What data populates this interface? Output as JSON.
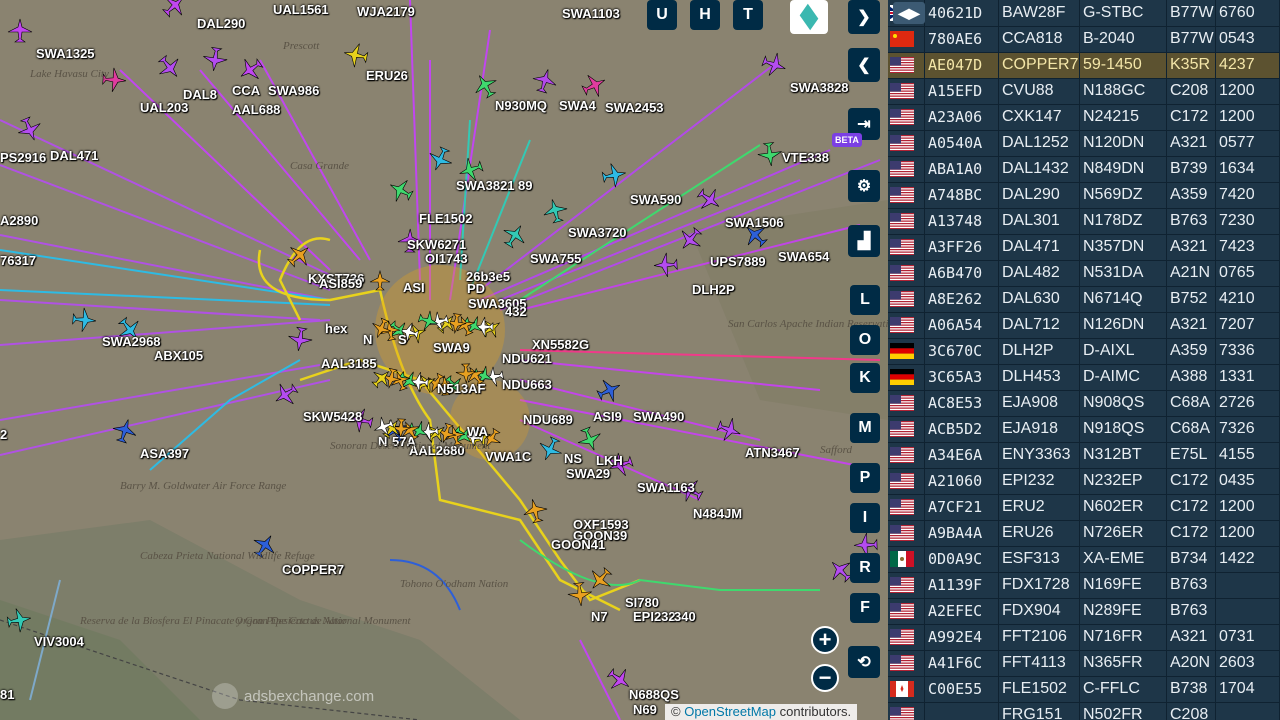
{
  "map": {
    "attribution_prefix": "©",
    "attribution_link": "OpenStreetMap",
    "attribution_suffix": "contributors.",
    "watermark": "adsbexchange.com",
    "beta_badge": "BETA",
    "place_labels": [
      "Prescott",
      "Lake Havasu City",
      "Barry M. Goldwater Air Force Range",
      "Cabeza Prieta National Wildlife Refuge",
      "Organ Pipe Cactus National Monument",
      "Tohono O'odham Nation",
      "Reserva de la Biosfera El Pinacate y Gran Desierto de Altar",
      "San Carlos Apache Indian Reservation",
      "Safford",
      "Casa Grande",
      "Sonoran Desert National Monument"
    ],
    "aircraft_labels": [
      "DAL290",
      "UAL1561",
      "WJA2179",
      "SWA1103",
      "SWA1325",
      "DAL8",
      "UAL203",
      "SWA986",
      "CCA",
      "AAL688",
      "ERU26",
      "N930MQ",
      "SWA4",
      "SWA2453",
      "SWA3828",
      "PS2916",
      "DAL471",
      "SWA3821",
      "89",
      "VTE338",
      "FLE1502",
      "SKW6271",
      "OI1743",
      "26b3e5",
      "SWA590",
      "A2890",
      "SWA3720",
      "SWA1506",
      "SWA755",
      "UPS7889",
      "SWA654",
      "76317",
      "KXST736",
      "ASI859",
      "ASI",
      "PD",
      "DLH2P",
      "SWA3605",
      "432",
      "hex",
      "N",
      "S",
      "SWA2968",
      "ABX105",
      "SWA9",
      "XN5582G",
      "NDU621",
      "AAL3185",
      "N513AF",
      "NDU663",
      "SKW5428",
      "ASI9",
      "SWA490",
      "NDU689",
      "N",
      "57A",
      "WA",
      "ASA397",
      "AAL2680",
      "VWA1C",
      "NS",
      "LKH",
      "ATN3467",
      "SWA29",
      "SWA1163",
      "N484JM",
      "OXF1593",
      "GOON39",
      "GOON41",
      "COPPER7",
      "VIV3004",
      "SI780",
      "EPI232",
      "N7",
      "340",
      "N688QS",
      "N69",
      "81",
      "2"
    ]
  },
  "toolbar": {
    "btn_u": "U",
    "btn_h": "H",
    "btn_t": "T",
    "expand_icon": "chevron-right-icon",
    "collapse_icon": "chevron-left-icon",
    "letter_buttons": [
      "L",
      "O",
      "K",
      "M",
      "P",
      "I",
      "R",
      "F"
    ],
    "zoom_in": "+",
    "zoom_out": "−"
  },
  "table": {
    "toggle_icon": "arrows-icon",
    "rows": [
      {
        "flag": "uk",
        "hex": "40621D",
        "callsign": "BAW28F",
        "reg": "G-STBC",
        "type": "B77W",
        "squawk": "6760"
      },
      {
        "flag": "cn",
        "hex": "780AE6",
        "callsign": "CCA818",
        "reg": "B-2040",
        "type": "B77W",
        "squawk": "0543"
      },
      {
        "flag": "us",
        "hex": "AE047D",
        "callsign": "COPPER7",
        "reg": "59-1450",
        "type": "K35R",
        "squawk": "4237",
        "selected": true
      },
      {
        "flag": "us",
        "hex": "A15EFD",
        "callsign": "CVU88",
        "reg": "N188GC",
        "type": "C208",
        "squawk": "1200"
      },
      {
        "flag": "us",
        "hex": "A23A06",
        "callsign": "CXK147",
        "reg": "N24215",
        "type": "C172",
        "squawk": "1200"
      },
      {
        "flag": "us",
        "hex": "A0540A",
        "callsign": "DAL1252",
        "reg": "N120DN",
        "type": "A321",
        "squawk": "0577"
      },
      {
        "flag": "us",
        "hex": "ABA1A0",
        "callsign": "DAL1432",
        "reg": "N849DN",
        "type": "B739",
        "squawk": "1634"
      },
      {
        "flag": "us",
        "hex": "A748BC",
        "callsign": "DAL290",
        "reg": "N569DZ",
        "type": "A359",
        "squawk": "7420"
      },
      {
        "flag": "us",
        "hex": "A13748",
        "callsign": "DAL301",
        "reg": "N178DZ",
        "type": "B763",
        "squawk": "7230"
      },
      {
        "flag": "us",
        "hex": "A3FF26",
        "callsign": "DAL471",
        "reg": "N357DN",
        "type": "A321",
        "squawk": "7423"
      },
      {
        "flag": "us",
        "hex": "A6B470",
        "callsign": "DAL482",
        "reg": "N531DA",
        "type": "A21N",
        "squawk": "0765"
      },
      {
        "flag": "us",
        "hex": "A8E262",
        "callsign": "DAL630",
        "reg": "N6714Q",
        "type": "B752",
        "squawk": "4210"
      },
      {
        "flag": "us",
        "hex": "A06A54",
        "callsign": "DAL712",
        "reg": "N126DN",
        "type": "A321",
        "squawk": "7207"
      },
      {
        "flag": "de",
        "hex": "3C670C",
        "callsign": "DLH2P",
        "reg": "D-AIXL",
        "type": "A359",
        "squawk": "7336"
      },
      {
        "flag": "de",
        "hex": "3C65A3",
        "callsign": "DLH453",
        "reg": "D-AIMC",
        "type": "A388",
        "squawk": "1331"
      },
      {
        "flag": "us",
        "hex": "AC8E53",
        "callsign": "EJA908",
        "reg": "N908QS",
        "type": "C68A",
        "squawk": "2726"
      },
      {
        "flag": "us",
        "hex": "ACB5D2",
        "callsign": "EJA918",
        "reg": "N918QS",
        "type": "C68A",
        "squawk": "7326"
      },
      {
        "flag": "us",
        "hex": "A34E6A",
        "callsign": "ENY3363",
        "reg": "N312BT",
        "type": "E75L",
        "squawk": "4155"
      },
      {
        "flag": "us",
        "hex": "A21060",
        "callsign": "EPI232",
        "reg": "N232EP",
        "type": "C172",
        "squawk": "0435"
      },
      {
        "flag": "us",
        "hex": "A7CF21",
        "callsign": "ERU2",
        "reg": "N602ER",
        "type": "C172",
        "squawk": "1200"
      },
      {
        "flag": "us",
        "hex": "A9BA4A",
        "callsign": "ERU26",
        "reg": "N726ER",
        "type": "C172",
        "squawk": "1200"
      },
      {
        "flag": "mx",
        "hex": "0D0A9C",
        "callsign": "ESF313",
        "reg": "XA-EME",
        "type": "B734",
        "squawk": "1422"
      },
      {
        "flag": "us",
        "hex": "A1139F",
        "callsign": "FDX1728",
        "reg": "N169FE",
        "type": "B763",
        "squawk": ""
      },
      {
        "flag": "us",
        "hex": "A2EFEC",
        "callsign": "FDX904",
        "reg": "N289FE",
        "type": "B763",
        "squawk": ""
      },
      {
        "flag": "us",
        "hex": "A992E4",
        "callsign": "FFT2106",
        "reg": "N716FR",
        "type": "A321",
        "squawk": "0731"
      },
      {
        "flag": "us",
        "hex": "A41F6C",
        "callsign": "FFT4113",
        "reg": "N365FR",
        "type": "A20N",
        "squawk": "2603"
      },
      {
        "flag": "ca",
        "hex": "C00E55",
        "callsign": "FLE1502",
        "reg": "C-FFLC",
        "type": "B738",
        "squawk": "1704"
      },
      {
        "flag": "us",
        "hex": "",
        "callsign": "FRG151",
        "reg": "N502FR",
        "type": "C208",
        "squawk": ""
      }
    ]
  },
  "colors": {
    "panel_bg": "#1e3648",
    "selected_row": "#5c5230",
    "button_bg": "#002b45"
  }
}
